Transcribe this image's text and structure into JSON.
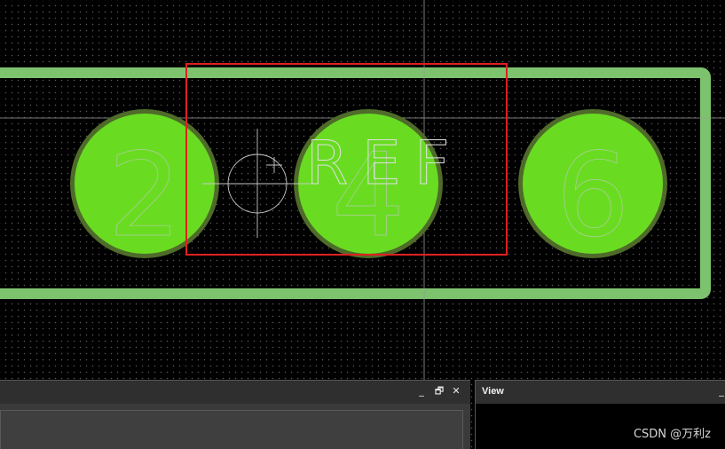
{
  "designator": "REF",
  "pad_labels": [
    "2",
    "4",
    "6"
  ],
  "colors": {
    "background": "#000000",
    "grid_dot": "#5a5a5a",
    "outline": "#7dc36d",
    "pad_fill": "#69dc22",
    "pad_ring": "#4f6b2a",
    "selection": "#e02020",
    "overlay": "#c8c8c8"
  },
  "panel_left": {
    "buttons": {
      "minimize": "_",
      "restore": "🗗",
      "close": "✕"
    }
  },
  "view_panel": {
    "title": "View",
    "minimize": "_"
  },
  "watermark": "CSDN @万利z"
}
